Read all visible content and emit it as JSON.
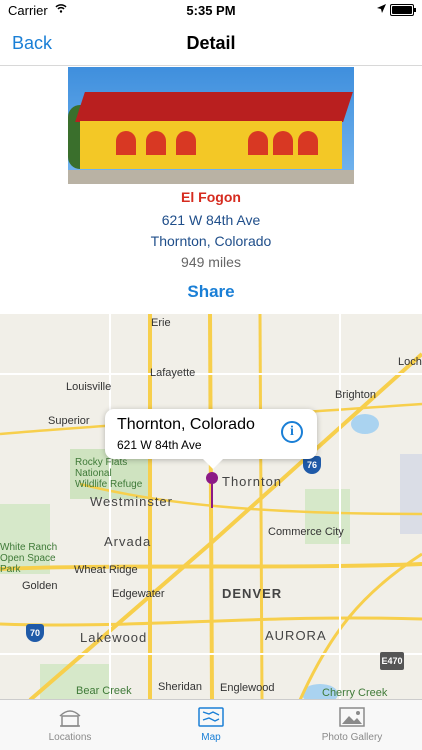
{
  "status_bar": {
    "carrier": "Carrier",
    "time": "5:35 PM"
  },
  "nav": {
    "back_label": "Back",
    "title": "Detail"
  },
  "location": {
    "name": "El Fogon",
    "address_line1": "621 W 84th Ave",
    "address_line2": "Thornton, Colorado",
    "distance": "949 miles"
  },
  "share_label": "Share",
  "map": {
    "callout_title": "Thornton, Colorado",
    "callout_subtitle": "621 W 84th Ave",
    "labels": [
      "Erie",
      "Lafayette",
      "Louisville",
      "Brighton",
      "Superior",
      "Thornton",
      "Rocky Flats National Wildlife Refuge",
      "Westminster",
      "Commerce City",
      "Arvada",
      "White Ranch Open Space Park",
      "Wheat Ridge",
      "Golden",
      "Edgewater",
      "DENVER",
      "Lakewood",
      "AURORA",
      "Bear Creek",
      "Sheridan",
      "Englewood",
      "Cherry Creek",
      "Loch"
    ],
    "shields": [
      "76",
      "70",
      "E470"
    ]
  },
  "tabs": [
    {
      "label": "Locations",
      "icon": "locations-icon"
    },
    {
      "label": "Map",
      "icon": "map-icon"
    },
    {
      "label": "Photo Gallery",
      "icon": "photo-gallery-icon"
    }
  ],
  "colors": {
    "accent": "#1a7fd6",
    "name_red": "#d62b1f",
    "address_blue": "#1f4e8a",
    "pin_purple": "#8c1a86"
  }
}
